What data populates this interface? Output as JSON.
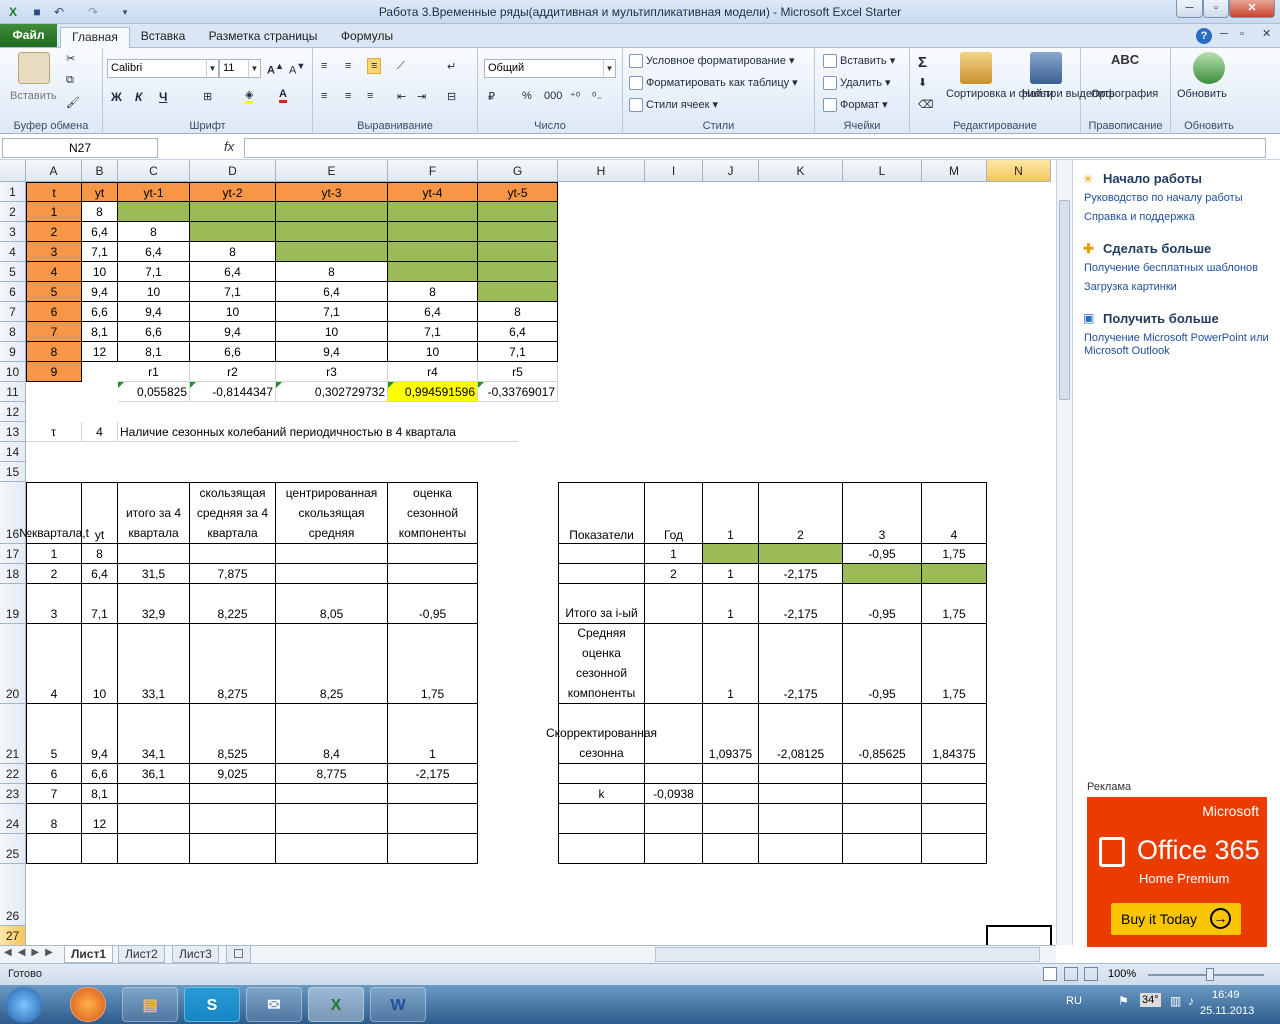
{
  "window": {
    "title": "Работа 3.Временные ряды(аддитивная и мультипликативная модели)  -  Microsoft Excel Starter"
  },
  "tabs": [
    "Файл",
    "Главная",
    "Вставка",
    "Разметка страницы",
    "Формулы"
  ],
  "ribbon": {
    "clipboard": {
      "paste": "Вставить",
      "label": "Буфер обмена"
    },
    "font": {
      "name": "Calibri",
      "size": "11",
      "bold": "Ж",
      "italic": "К",
      "underline": "Ч",
      "label": "Шрифт"
    },
    "align": {
      "label": "Выравнивание"
    },
    "number": {
      "format": "Общий",
      "label": "Число",
      "percent": "%",
      "thousands": "000"
    },
    "styles": {
      "cond": "Условное форматирование",
      "table": "Форматировать как таблицу",
      "cell": "Стили ячеек",
      "label": "Стили"
    },
    "cells": {
      "insert": "Вставить",
      "delete": "Удалить",
      "format": "Формат",
      "label": "Ячейки"
    },
    "editing": {
      "sort": "Сортировка и фильтр",
      "find": "Найти и выделить",
      "label": "Редактирование"
    },
    "proof": {
      "spell": "Орфография",
      "label": "Правописание",
      "abc": "ABC"
    },
    "update": {
      "upd": "Обновить",
      "label": "Обновить"
    },
    "sigma": "Σ"
  },
  "formula_bar": {
    "namebox": "N27",
    "fx": "fx",
    "value": ""
  },
  "columns": [
    "A",
    "B",
    "C",
    "D",
    "E",
    "F",
    "G",
    "H",
    "I",
    "J",
    "K",
    "L",
    "M",
    "N"
  ],
  "rows": [
    "1",
    "2",
    "3",
    "4",
    "5",
    "6",
    "7",
    "8",
    "9",
    "10",
    "11",
    "12",
    "13",
    "14",
    "15",
    "16",
    "17",
    "18",
    "19",
    "20",
    "21",
    "22",
    "23",
    "24",
    "25",
    "26",
    "27"
  ],
  "cells": {
    "A1": "t",
    "B1": "yt",
    "C1": "yt-1",
    "D1": "yt-2",
    "E1": "yt-3",
    "F1": "yt-4",
    "G1": "yt-5",
    "A2": "1",
    "B2": "8",
    "A3": "2",
    "B3": "6,4",
    "C3": "8",
    "A4": "3",
    "B4": "7,1",
    "C4": "6,4",
    "D4": "8",
    "A5": "4",
    "B5": "10",
    "C5": "7,1",
    "D5": "6,4",
    "E5": "8",
    "A6": "5",
    "B6": "9,4",
    "C6": "10",
    "D6": "7,1",
    "E6": "6,4",
    "F6": "8",
    "A7": "6",
    "B7": "6,6",
    "C7": "9,4",
    "D7": "10",
    "E7": "7,1",
    "F7": "6,4",
    "G7": "8",
    "A8": "7",
    "B8": "8,1",
    "C8": "6,6",
    "D8": "9,4",
    "E8": "10",
    "F8": "7,1",
    "G8": "6,4",
    "A9": "8",
    "B9": "12",
    "C9": "8,1",
    "D9": "6,6",
    "E9": "9,4",
    "F9": "10",
    "G9": "7,1",
    "A10": "9",
    "C10": "r1",
    "D10": "r2",
    "E10": "r3",
    "F10": "r4",
    "G10": "r5",
    "C11": "0,055825",
    "D11": "-0,8144347",
    "E11": "0,302729732",
    "F11": "0,994591596",
    "G11": "-0,33769017",
    "A13": "τ",
    "B13": "4",
    "C13": "Наличие сезонных колебаний периодичностью в 4 квартала",
    "A16": "№квартала,t",
    "B16": "yt",
    "C16": "итого за 4 квартала",
    "D16": "скользящая средняя за 4 квартала",
    "E16": "центрированная скользящая средняя",
    "F16": "оценка сезонной компоненты",
    "H16": "Показатели",
    "I16": "Год",
    "J16": "1",
    "K16": "2",
    "L16": "3",
    "M16": "4",
    "A17": "1",
    "B17": "8",
    "I17": "1",
    "L17": "-0,95",
    "M17": "1,75",
    "A18": "2",
    "B18": "6,4",
    "C18": "31,5",
    "D18": "7,875",
    "I18": "2",
    "J18": "1",
    "K18": "-2,175",
    "A19": "3",
    "B19": "7,1",
    "C19": "32,9",
    "D19": "8,225",
    "E19": "8,05",
    "F19": "-0,95",
    "H19": "Итого за i-ый",
    "J19": "1",
    "K19": "-2,175",
    "L19": "-0,95",
    "M19": "1,75",
    "A20": "4",
    "B20": "10",
    "C20": "33,1",
    "D20": "8,275",
    "E20": "8,25",
    "F20": "1,75",
    "H20": "Средняя оценка сезонной компоненты",
    "J20": "1",
    "K20": "-2,175",
    "L20": "-0,95",
    "M20": "1,75",
    "A21": "5",
    "B21": "9,4",
    "C21": "34,1",
    "D21": "8,525",
    "E21": "8,4",
    "F21": "1",
    "H21": "Скорректированная сезонна",
    "J21": "1,09375",
    "K21": "-2,08125",
    "L21": "-0,85625",
    "M21": "1,84375",
    "A22": "6",
    "B22": "6,6",
    "C22": "36,1",
    "D22": "9,025",
    "E22": "8,775",
    "F22": "-2,175",
    "A23": "7",
    "B23": "8,1",
    "H23": "k",
    "I23": "-0,0938",
    "A24": "8",
    "B24": "12"
  },
  "panel": {
    "h1": "Начало работы",
    "l1": "Руководство по началу работы",
    "l2": "Справка и поддержка",
    "h2": "Сделать больше",
    "l3": "Получение бесплатных шаблонов",
    "l4": "Загрузка картинки",
    "h3": "Получить больше",
    "l5": "Получение Microsoft PowerPoint или Microsoft Outlook",
    "ad": "Реклама",
    "ad_brand": "Microsoft",
    "ad_product": "Office 365",
    "ad_sub": "Home Premium",
    "ad_btn": "Buy it Today"
  },
  "sheets": [
    "Лист1",
    "Лист2",
    "Лист3"
  ],
  "status": {
    "ready": "Готово",
    "zoom": "100%"
  },
  "taskbar": {
    "lang": "RU",
    "temp": "34°",
    "time": "16:49",
    "date": "25.11.2013"
  },
  "colors": {
    "orange": "#f79646",
    "green": "#9bbb59",
    "yellow": "#ffff00",
    "accent": "#1e6c1f"
  }
}
